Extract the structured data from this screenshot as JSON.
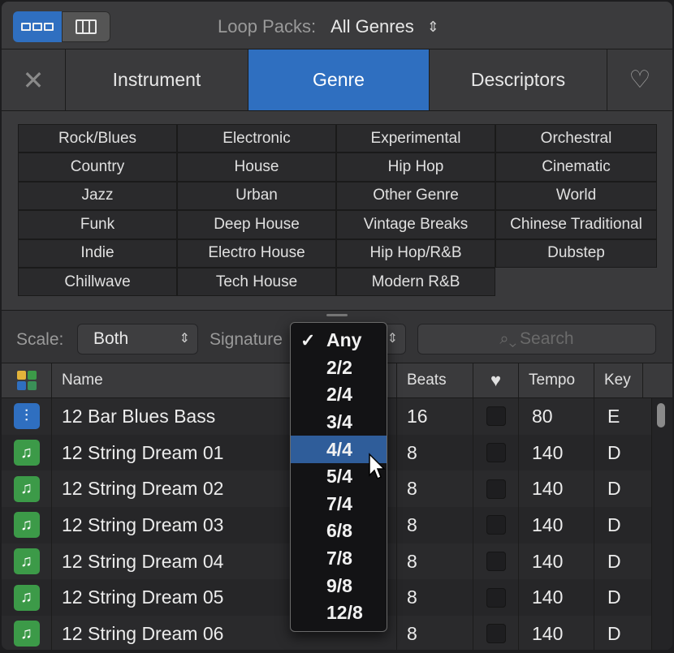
{
  "topbar": {
    "loop_packs_label": "Loop Packs:",
    "loop_packs_value": "All Genres",
    "view_toggle": [
      "grid-rows-icon",
      "columns-icon"
    ]
  },
  "tabs": {
    "instrument": "Instrument",
    "genre": "Genre",
    "descriptors": "Descriptors",
    "active": "Genre"
  },
  "genres": [
    "Rock/Blues",
    "Electronic",
    "Experimental",
    "Orchestral",
    "Country",
    "House",
    "Hip Hop",
    "Cinematic",
    "Jazz",
    "Urban",
    "Other Genre",
    "World",
    "Funk",
    "Deep House",
    "Vintage Breaks",
    "Chinese Traditional",
    "Indie",
    "Electro House",
    "Hip Hop/R&B",
    "Dubstep",
    "Chillwave",
    "Tech House",
    "Modern R&B"
  ],
  "filters": {
    "scale_label": "Scale:",
    "scale_value": "Both",
    "signature_label": "Signature",
    "search_placeholder": "Search"
  },
  "table": {
    "headers": {
      "name": "Name",
      "beats": "Beats",
      "tempo": "Tempo",
      "key": "Key"
    },
    "rows": [
      {
        "kind": "audio",
        "name": "12 Bar Blues Bass",
        "beats": "16",
        "tempo": "80",
        "key": "E"
      },
      {
        "kind": "midi",
        "name": "12 String Dream 01",
        "beats": "8",
        "tempo": "140",
        "key": "D"
      },
      {
        "kind": "midi",
        "name": "12 String Dream 02",
        "beats": "8",
        "tempo": "140",
        "key": "D"
      },
      {
        "kind": "midi",
        "name": "12 String Dream 03",
        "beats": "8",
        "tempo": "140",
        "key": "D"
      },
      {
        "kind": "midi",
        "name": "12 String Dream 04",
        "beats": "8",
        "tempo": "140",
        "key": "D"
      },
      {
        "kind": "midi",
        "name": "12 String Dream 05",
        "beats": "8",
        "tempo": "140",
        "key": "D"
      },
      {
        "kind": "midi",
        "name": "12 String Dream 06",
        "beats": "8",
        "tempo": "140",
        "key": "D"
      }
    ]
  },
  "signature_menu": {
    "items": [
      "Any",
      "2/2",
      "2/4",
      "3/4",
      "4/4",
      "5/4",
      "7/4",
      "6/8",
      "7/8",
      "9/8",
      "12/8"
    ],
    "checked": "Any",
    "highlighted": "4/4"
  },
  "colors": {
    "accent": "#2f6fc0",
    "audio_icon": "#2f6fc0",
    "midi_icon": "#3c9a48",
    "quad": [
      "#e2b33a",
      "#3c9a48",
      "#2f6fc0",
      "#3a8f57"
    ]
  }
}
